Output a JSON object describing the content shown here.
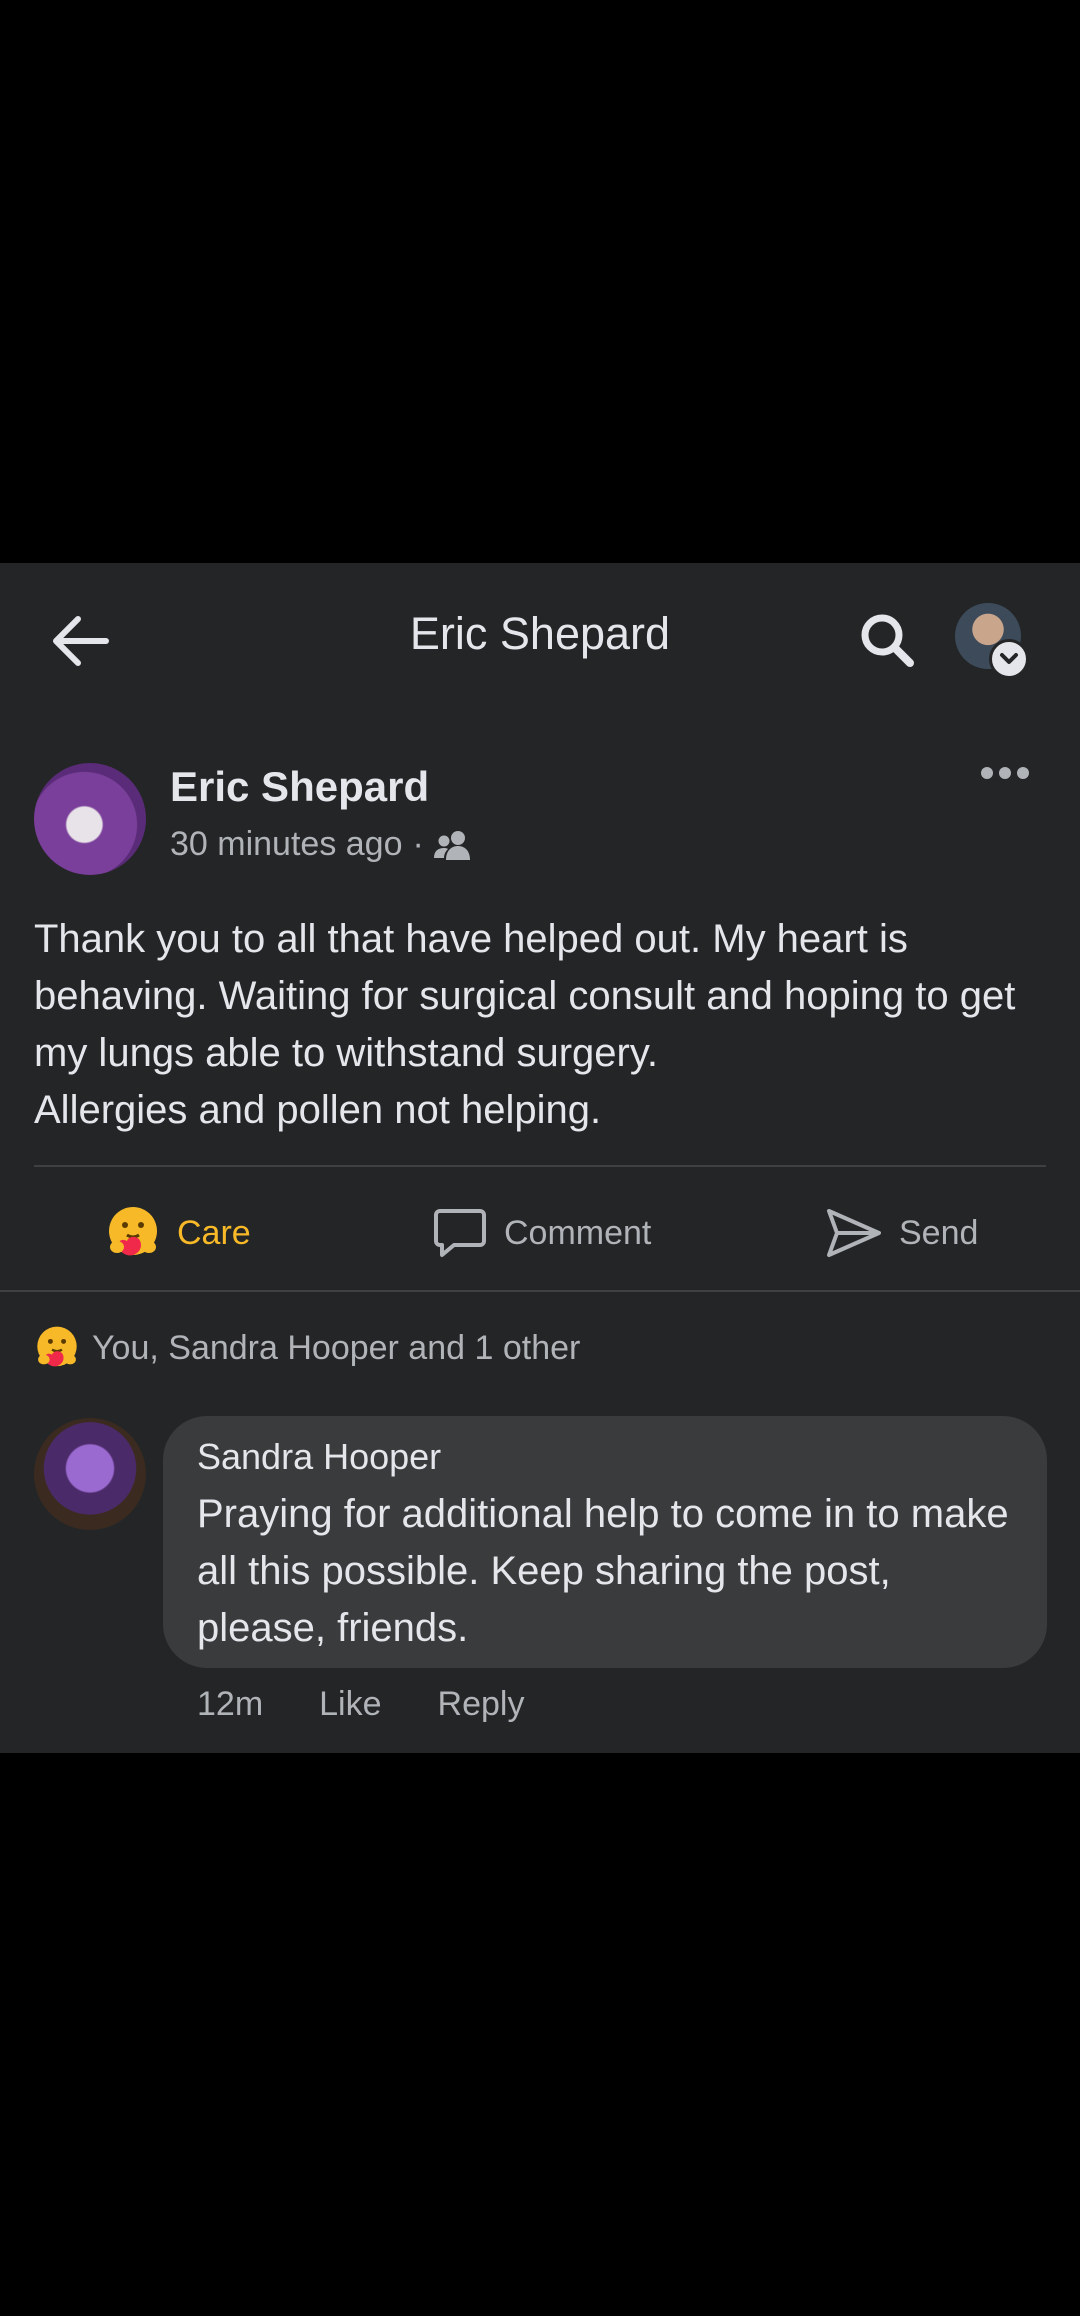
{
  "header": {
    "title": "Eric Shepard",
    "back_icon": "arrow-left-icon",
    "search_icon": "search-icon"
  },
  "post": {
    "author": "Eric Shepard",
    "time": "30 minutes ago",
    "separator": "·",
    "audience_icon": "friends-icon",
    "body": "Thank you to all that have helped out. My heart is behaving. Waiting for surgical consult and hoping to get my lungs able to withstand surgery.\nAllergies and pollen not helping."
  },
  "actions": {
    "care_label": "Care",
    "comment_label": "Comment",
    "send_label": "Send"
  },
  "reactions": {
    "summary": "You, Sandra Hooper and 1 other"
  },
  "comment": {
    "author": "Sandra Hooper",
    "text": "Praying for additional help to come in to make all this possible.  Keep sharing the post, please, friends.",
    "time": "12m",
    "like_label": "Like",
    "reply_label": "Reply"
  },
  "colors": {
    "background": "#000000",
    "panel": "#242526",
    "bubble": "#3a3b3c",
    "care_accent": "#f7b928",
    "secondary_text": "#b0b3b8"
  }
}
